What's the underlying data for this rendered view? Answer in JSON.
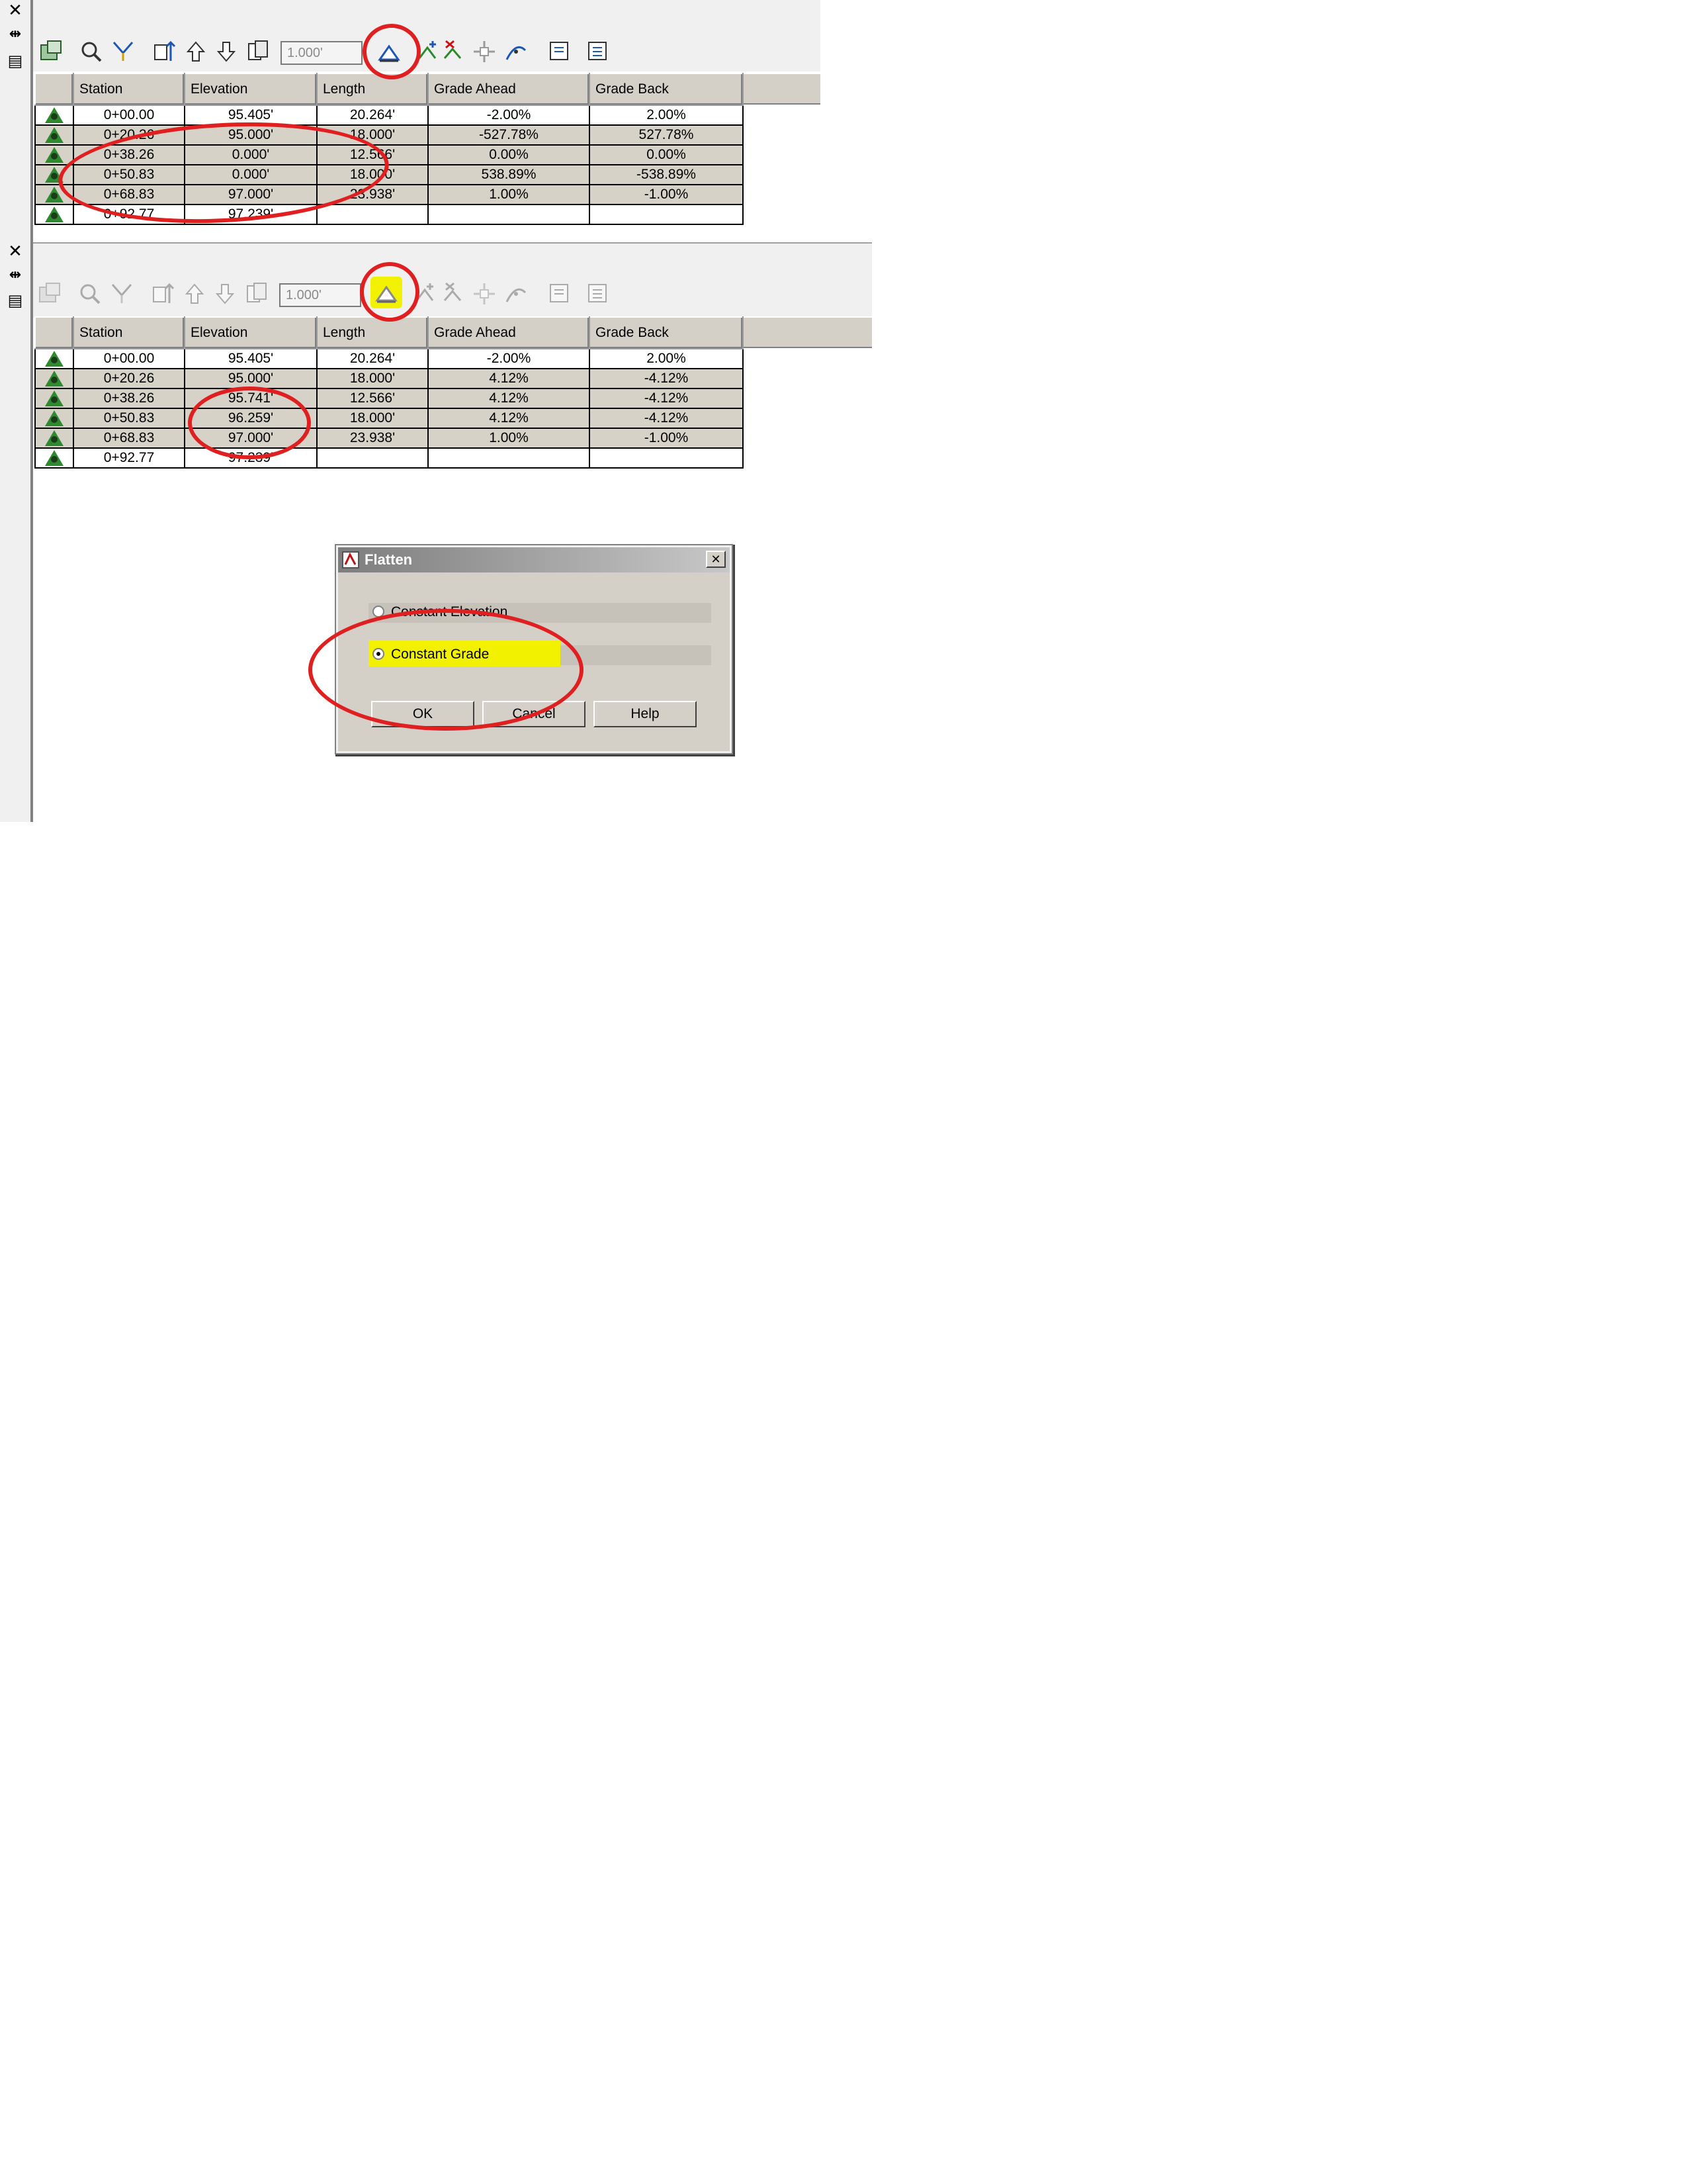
{
  "top_panel": {
    "scale_value": "1.000'",
    "columns": [
      "Station",
      "Elevation",
      "Length",
      "Grade Ahead",
      "Grade Back"
    ],
    "rows": [
      {
        "station": "0+00.00",
        "elevation": "95.405'",
        "length": "20.264'",
        "grade_ahead": "-2.00%",
        "grade_back": "2.00%"
      },
      {
        "station": "0+20.26",
        "elevation": "95.000'",
        "length": "18.000'",
        "grade_ahead": "-527.78%",
        "grade_back": "527.78%"
      },
      {
        "station": "0+38.26",
        "elevation": "0.000'",
        "length": "12.566'",
        "grade_ahead": "0.00%",
        "grade_back": "0.00%"
      },
      {
        "station": "0+50.83",
        "elevation": "0.000'",
        "length": "18.000'",
        "grade_ahead": "538.89%",
        "grade_back": "-538.89%"
      },
      {
        "station": "0+68.83",
        "elevation": "97.000'",
        "length": "23.938'",
        "grade_ahead": "1.00%",
        "grade_back": "-1.00%"
      },
      {
        "station": "0+92.77",
        "elevation": "97.239'",
        "length": "",
        "grade_ahead": "",
        "grade_back": ""
      }
    ]
  },
  "bottom_panel": {
    "scale_value": "1.000'",
    "columns": [
      "Station",
      "Elevation",
      "Length",
      "Grade Ahead",
      "Grade Back"
    ],
    "rows": [
      {
        "station": "0+00.00",
        "elevation": "95.405'",
        "length": "20.264'",
        "grade_ahead": "-2.00%",
        "grade_back": "2.00%"
      },
      {
        "station": "0+20.26",
        "elevation": "95.000'",
        "length": "18.000'",
        "grade_ahead": "4.12%",
        "grade_back": "-4.12%"
      },
      {
        "station": "0+38.26",
        "elevation": "95.741'",
        "length": "12.566'",
        "grade_ahead": "4.12%",
        "grade_back": "-4.12%"
      },
      {
        "station": "0+50.83",
        "elevation": "96.259'",
        "length": "18.000'",
        "grade_ahead": "4.12%",
        "grade_back": "-4.12%"
      },
      {
        "station": "0+68.83",
        "elevation": "97.000'",
        "length": "23.938'",
        "grade_ahead": "1.00%",
        "grade_back": "-1.00%"
      },
      {
        "station": "0+92.77",
        "elevation": "97.239'",
        "length": "",
        "grade_ahead": "",
        "grade_back": ""
      }
    ]
  },
  "dialog": {
    "title": "Flatten",
    "close_glyph": "✕",
    "option_constant_elevation": "Constant Elevation",
    "option_constant_grade": "Constant Grade",
    "selected_option": "Constant Grade",
    "ok_label": "OK",
    "cancel_label": "Cancel",
    "help_label": "Help"
  },
  "side_buttons": {
    "close_glyph": "✕",
    "dock_glyph": "⇹",
    "props_glyph": "▤"
  },
  "colors": {
    "annotation_red": "#e02020",
    "highlight_yellow": "#f2f200",
    "grid_header": "#d4d0c8",
    "row_shade": "#d6d2c8",
    "pvi_green": "#2f8a2f"
  },
  "icons": [
    "pvi-table-icon",
    "zoom-icon",
    "select-pvi-icon",
    "raise-lower-icon",
    "up-arrow-icon",
    "down-arrow-icon",
    "copy-profile-icon",
    "flatten-icon",
    "insert-pvi-icon",
    "delete-pvi-icon",
    "move-pvi-icon",
    "curve-icon",
    "export-icon",
    "settings-icon"
  ]
}
